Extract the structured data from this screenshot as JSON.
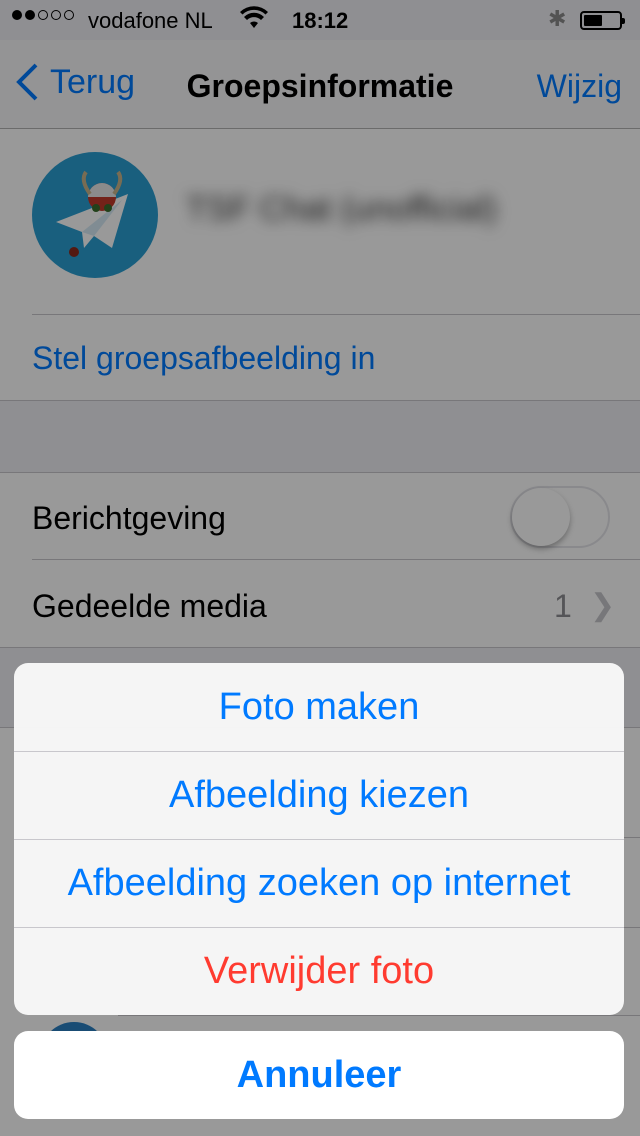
{
  "status_bar": {
    "carrier": "vodafone NL",
    "time": "18:12",
    "signal_dots_filled": 2,
    "signal_dots_total": 5
  },
  "nav": {
    "back_label": "Terug",
    "title": "Groepsinformatie",
    "edit_label": "Wijzig"
  },
  "group": {
    "name": "TSF Chat (unofficial)",
    "set_photo_label": "Stel groepsafbeelding in"
  },
  "settings": {
    "notifications_label": "Berichtgeving",
    "notifications_on": false,
    "shared_media_label": "Gedeelde media",
    "shared_media_count": "1"
  },
  "action_sheet": {
    "items": [
      {
        "label": "Foto maken",
        "destructive": false
      },
      {
        "label": "Afbeelding kiezen",
        "destructive": false
      },
      {
        "label": "Afbeelding zoeken op internet",
        "destructive": false
      },
      {
        "label": "Verwijder foto",
        "destructive": true
      }
    ],
    "cancel_label": "Annuleer"
  },
  "colors": {
    "accent": "#007aff",
    "destructive": "#ff3b30",
    "avatar_bg": "#2b9fd3"
  }
}
